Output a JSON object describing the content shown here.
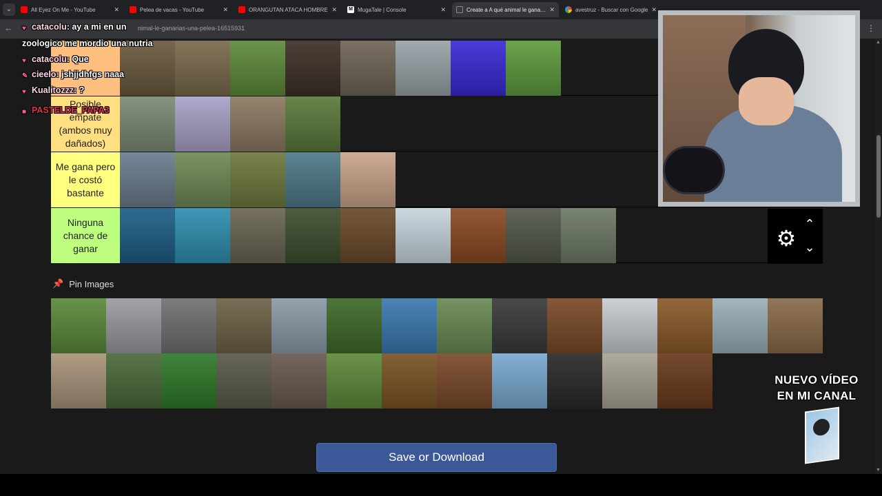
{
  "browser": {
    "tabs": [
      {
        "label": "All Eyez On Me - YouTube",
        "icon": "youtube-icon",
        "active": false
      },
      {
        "label": "Pelea de vacas - YouTube",
        "icon": "youtube-icon",
        "active": false
      },
      {
        "label": "ORANGUTAN ATACA HOMBRE",
        "icon": "youtube-icon",
        "active": false
      },
      {
        "label": "MugaTale | Console",
        "icon": "mugatale-icon",
        "active": false
      },
      {
        "label": "Create a A qué animal le ganarías",
        "icon": "tiermaker-icon",
        "active": true
      },
      {
        "label": "avestruz - Buscar con Google",
        "icon": "google-icon",
        "active": false
      }
    ],
    "url": "nimal-le-ganarias-una-pelea-16515931"
  },
  "chat": [
    {
      "badge": "heart-icon",
      "user": "catacolu",
      "message": ": ay a mi en un"
    },
    {
      "badge": "",
      "user": "",
      "message": "zoologico me mordio una nutria"
    },
    {
      "badge": "heart-icon",
      "user": "catacolu",
      "message": ": Que"
    },
    {
      "badge": "pencil-icon",
      "user": "cieelo",
      "message": ": jshjjdhfgs naaa"
    },
    {
      "badge": "heart-icon",
      "user": "Kualitozzz",
      "message": ": ?"
    },
    {
      "badge": "game-icon",
      "user": "PASTELDE_PAPA3",
      "message": ""
    }
  ],
  "tiers": [
    {
      "label": "",
      "color": "#ffbf7f",
      "items": [
        "sloth",
        "hyena",
        "tortoise",
        "komodo",
        "capybara",
        "crow",
        "octopus",
        "cow"
      ]
    },
    {
      "label": "Posible empate (ambos muy dañados)",
      "color": "#ffdf7f",
      "items": [
        "emu",
        "ostrich",
        "python",
        "anteater"
      ]
    },
    {
      "label": "Me gana pero le costó bastante",
      "color": "#ffff7f",
      "items": [
        "walrus",
        "kangaroo",
        "buffalo",
        "deer",
        "pitbull"
      ]
    },
    {
      "label": "Ninguna chance de ganar",
      "color": "#bfff7f",
      "items": [
        "whale",
        "shark",
        "elephant",
        "gorilla",
        "bear",
        "polar-bear",
        "orangutan",
        "hippo",
        "rhino"
      ]
    }
  ],
  "pin_images": {
    "title": "Pin Images",
    "items": [
      "parrot",
      "flamingo",
      "zebra",
      "owl",
      "giraffe",
      "panda",
      "dolphin",
      "rabbit",
      "wolf",
      "horse",
      "eagle",
      "tiger",
      "crocodile",
      "lion-family",
      "porcupine",
      "toucan",
      "frog",
      "komodo-dragon",
      "tarantula",
      "lapwing",
      "lion",
      "bull",
      "bat",
      "panther",
      "cougar",
      "orangutan-2"
    ]
  },
  "save_button": "Save or Download",
  "promo": {
    "line1": "NUEVO VÍDEO",
    "line2": "EN MI CANAL"
  },
  "colors": {
    "tile_palette": {
      "sloth": "#6b5a3e",
      "hyena": "#7a6a4c",
      "tortoise": "#5e8a3a",
      "komodo": "#3d3128",
      "capybara": "#6f6556",
      "crow": "#9aa3a8",
      "octopus": "#3a2ad6",
      "cow": "#5f9b3e",
      "emu": "#7d8a74",
      "ostrich": "#a8a3c8",
      "python": "#8c7a61",
      "anteater": "#5a7a3c",
      "walrus": "#6b7d8e",
      "kangaroo": "#6f8a58",
      "buffalo": "#6d7a3e",
      "deer": "#4e7a88",
      "pitbull": "#c9a58a",
      "whale": "#1d5f86",
      "shark": "#2f8fb0",
      "elephant": "#6a6552",
      "gorilla": "#3e4f30",
      "bear": "#6a4a2a",
      "polar-bear": "#c8d6df",
      "orangutan": "#8a4a24",
      "hippo": "#52584a",
      "rhino": "#6e7a64",
      "parrot": "#5b8a3b",
      "flamingo": "#9a9aa0",
      "zebra": "#707070",
      "owl": "#6e6246",
      "giraffe": "#8a9aa8",
      "panda": "#3f6a2a",
      "dolphin": "#3a7ab0",
      "rabbit": "#6a8a55",
      "wolf": "#3a3a3a",
      "horse": "#7a4a28",
      "eagle": "#c8ccd0",
      "tiger": "#8a5a2a",
      "crocodile": "#9ab0b8",
      "lion-family": "#8a6a4a",
      "porcupine": "#a8947a",
      "toucan": "#4a6a3a",
      "frog": "#2f7a2a",
      "komodo-dragon": "#5a5a4a",
      "tarantula": "#6a5a50",
      "lapwing": "#5f8a3a",
      "lion": "#7a5424",
      "bull": "#7a4a2a",
      "bat": "#7aaad0",
      "panther": "#2a2a2a",
      "cougar": "#a8a392",
      "orangutan-2": "#6a3a1e"
    }
  }
}
